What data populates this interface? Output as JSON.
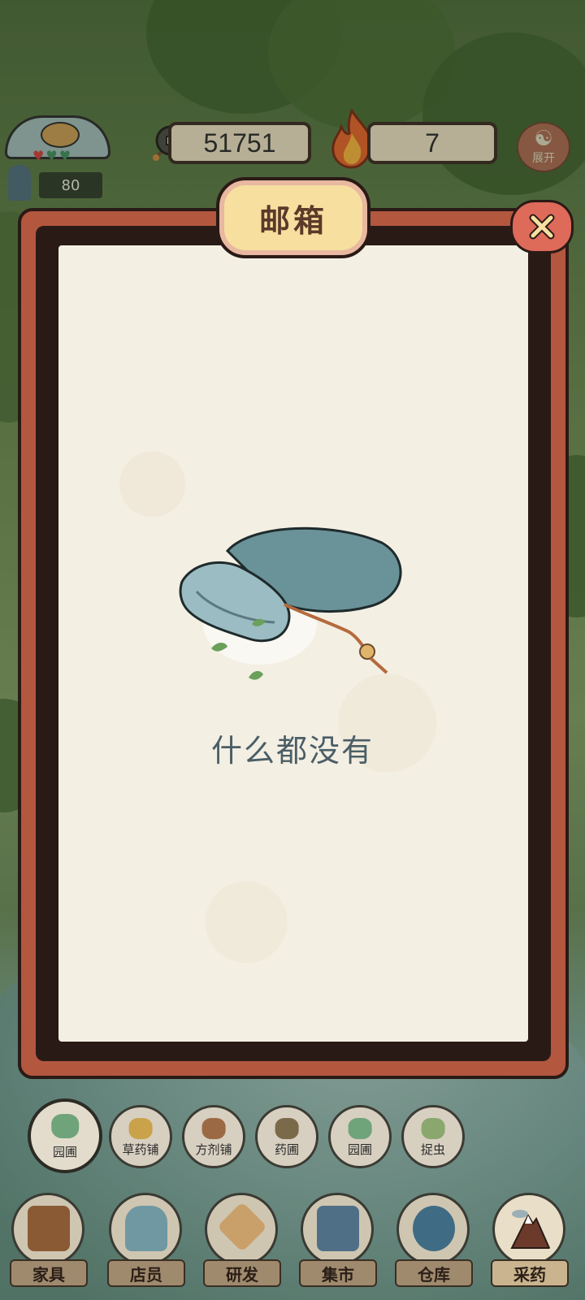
{
  "hud": {
    "exp_value": "80",
    "money": "51751",
    "fire": "7",
    "expand_label": "展开"
  },
  "mailbox": {
    "title": "邮箱",
    "empty_text": "什么都没有"
  },
  "categories": [
    {
      "label": "园圃",
      "icon": "leaf-bundle-icon",
      "active": true
    },
    {
      "label": "草药铺",
      "icon": "herb-basket-icon",
      "active": false
    },
    {
      "label": "方剂铺",
      "icon": "mortar-icon",
      "active": false
    },
    {
      "label": "药圃",
      "icon": "sprout-icon",
      "active": false
    },
    {
      "label": "园圃",
      "icon": "leaf-bundle-icon",
      "active": false
    },
    {
      "label": "捉虫",
      "icon": "bug-plant-icon",
      "active": false
    }
  ],
  "nav": [
    {
      "label": "家具",
      "icon": "chair-icon"
    },
    {
      "label": "店员",
      "icon": "clerk-icon"
    },
    {
      "label": "研发",
      "icon": "package-icon"
    },
    {
      "label": "集市",
      "icon": "banner-icon"
    },
    {
      "label": "仓库",
      "icon": "bundle-icon"
    },
    {
      "label": "采药",
      "icon": "mountain-icon"
    }
  ],
  "colors": {
    "dialog_frame": "#b3573f",
    "title_plate": "#f6df9f",
    "close_button": "#de6a5a",
    "paper": "#f4efe3",
    "empty_text": "#4a5e66"
  }
}
